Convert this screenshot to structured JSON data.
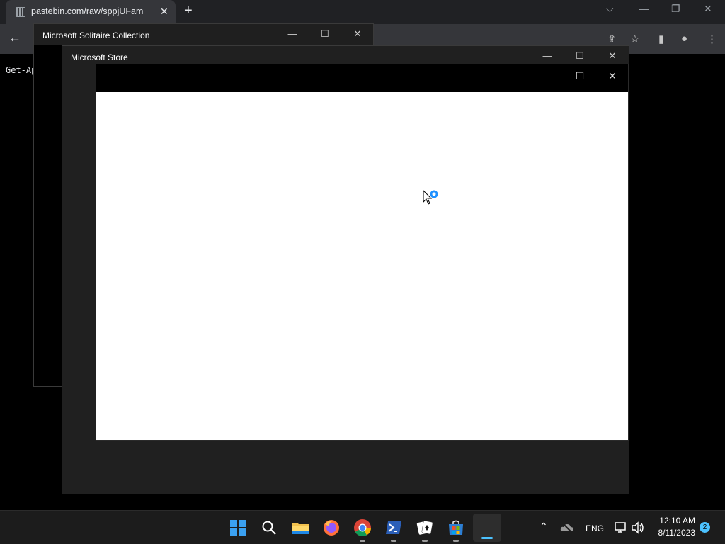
{
  "browser": {
    "tab_title": "pastebin.com/raw/sppjUFam",
    "page_text": "Get-Ap"
  },
  "solitaire": {
    "title": "Microsoft Solitaire Collection"
  },
  "store": {
    "title": "Microsoft Store"
  },
  "taskbar": {
    "apps": [
      "start-icon",
      "search-icon",
      "file-explorer-icon",
      "firefox-icon",
      "chrome-icon",
      "powershell-icon",
      "solitaire-icon",
      "store-icon",
      "active-app"
    ],
    "language": "ENG",
    "time": "12:10 AM",
    "date": "8/11/2023",
    "notifications": "2"
  },
  "colors": {
    "accent": "#4cc2ff",
    "spinner": "#1e90ff"
  }
}
